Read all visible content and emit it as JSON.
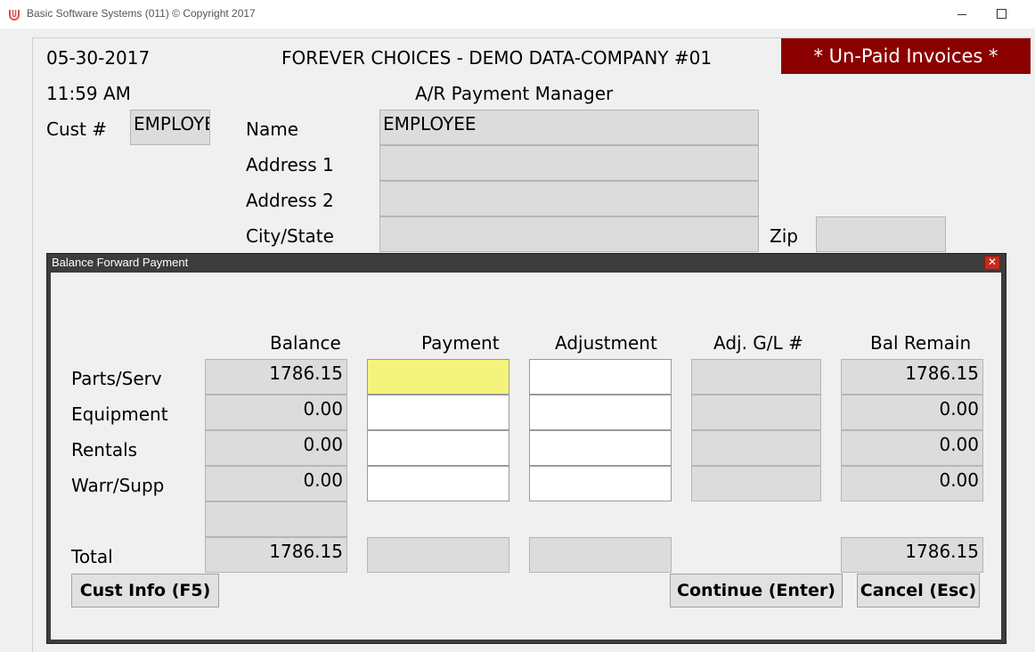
{
  "window": {
    "title": "Basic Software Systems (011) © Copyright 2017"
  },
  "header": {
    "date": "05-30-2017",
    "time": "11:59 AM",
    "company": "FOREVER CHOICES - DEMO DATA-COMPANY #01",
    "subtitle": "A/R Payment Manager",
    "banner": "* Un-Paid Invoices *"
  },
  "customer": {
    "cust_label": "Cust #",
    "cust_value": "EMPLOYEE",
    "name_label": "Name",
    "name_value": "EMPLOYEE",
    "address1_label": "Address 1",
    "address1_value": "",
    "address2_label": "Address 2",
    "address2_value": "",
    "citystate_label": "City/State",
    "citystate_value": "",
    "zip_label": "Zip",
    "zip_value": ""
  },
  "dialog": {
    "title": "Balance Forward Payment",
    "close_label": "✕",
    "columns": [
      "Balance",
      "Payment",
      "Adjustment",
      "Adj. G/L #",
      "Bal Remain"
    ],
    "rows": [
      {
        "label": "Parts/Serv",
        "balance": "1786.15",
        "bal_remain": "1786.15"
      },
      {
        "label": "Equipment",
        "balance": "0.00",
        "bal_remain": "0.00"
      },
      {
        "label": "Rentals",
        "balance": "0.00",
        "bal_remain": "0.00"
      },
      {
        "label": "Warr/Supp",
        "balance": "0.00",
        "bal_remain": "0.00"
      }
    ],
    "total_label": "Total",
    "total_balance": "1786.15",
    "total_bal_remain": "1786.15",
    "buttons": {
      "cust_info": "Cust Info (F5)",
      "continue": "Continue (Enter)",
      "cancel": "Cancel (Esc)"
    }
  },
  "colors": {
    "banner_bg": "#8a0000",
    "active_input": "#f4f47c",
    "close_button": "#c42b1c"
  }
}
